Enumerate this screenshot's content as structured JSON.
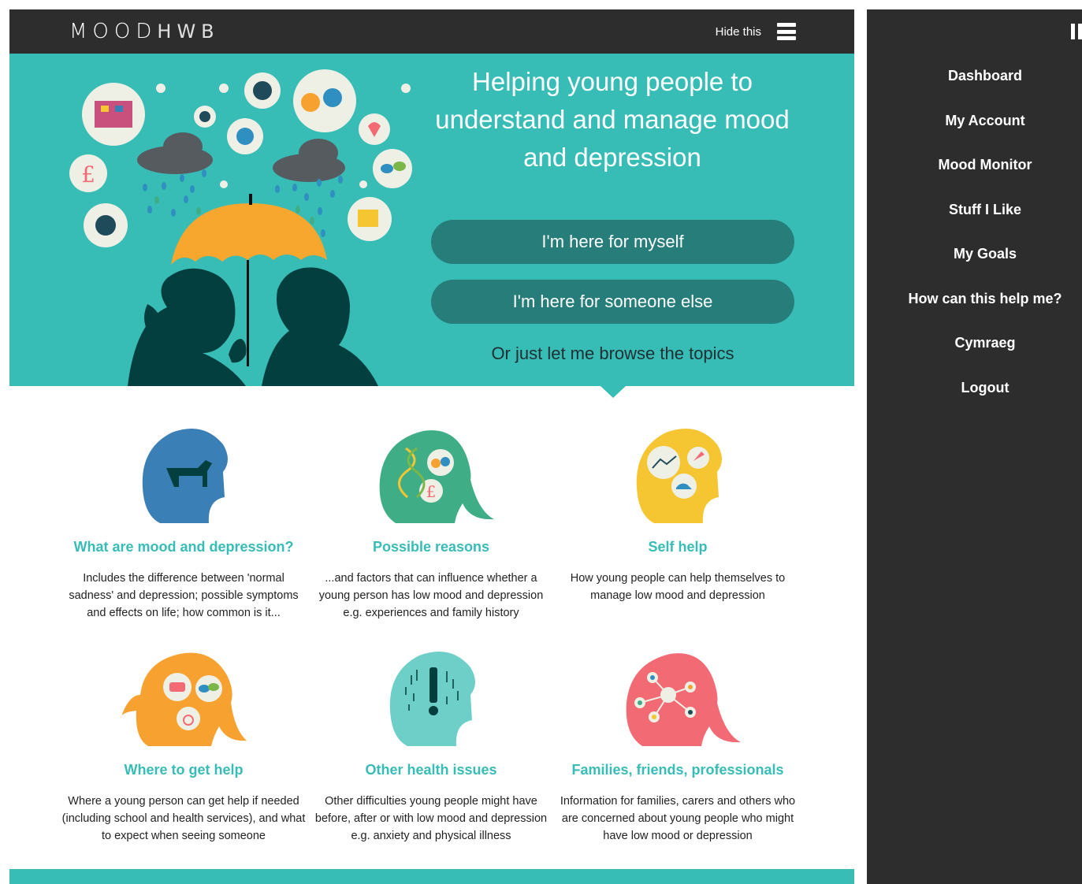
{
  "brand": {
    "logo_bold": "MOOD",
    "logo_thin": "HWB"
  },
  "header": {
    "hide_label": "Hide this",
    "menu_icon": "hamburger-icon"
  },
  "hero": {
    "title": "Helping young people to understand and manage mood and depression",
    "button_myself": "I'm here for myself",
    "button_someone": "I'm here for someone else",
    "browse_link": "Or just let me browse the topics"
  },
  "topics": [
    {
      "title": "What are mood and depression?",
      "description": "Includes the difference between 'normal sadness' and depression; possible symptoms and effects on life; how common is it...",
      "color": "#3a7fb5",
      "icon": "dog-head-icon"
    },
    {
      "title": "Possible reasons",
      "description": "...and factors that can influence whether a young person has low mood and depression e.g. experiences and family history",
      "color": "#3fae87",
      "icon": "reasons-head-icon"
    },
    {
      "title": "Self help",
      "description": "How young people can help themselves to manage low mood and depression",
      "color": "#f5c532",
      "icon": "self-help-head-icon"
    },
    {
      "title": "Where to get help",
      "description": "Where a young person can get help if needed (including school and health services), and what to expect when seeing someone",
      "color": "#f7a230",
      "icon": "help-head-icon"
    },
    {
      "title": "Other health issues",
      "description": "Other difficulties young people might have before, after or with low mood and depression e.g. anxiety and physical illness",
      "color": "#6ecfc9",
      "icon": "exclamation-head-icon"
    },
    {
      "title": "Families, friends, professionals",
      "description": "Information for families, carers and others who are concerned about young people who might have low mood or depression",
      "color": "#f26b74",
      "icon": "network-head-icon"
    }
  ],
  "sidebar": {
    "items": [
      {
        "label": "Dashboard"
      },
      {
        "label": "My Account"
      },
      {
        "label": "Mood Monitor"
      },
      {
        "label": "Stuff I Like"
      },
      {
        "label": "My Goals"
      },
      {
        "label": "How can this help me?"
      },
      {
        "label": "Cymraeg"
      },
      {
        "label": "Logout"
      }
    ]
  },
  "colors": {
    "teal": "#38bcb6",
    "dark_teal": "#277d7a",
    "dark": "#2d2d2d"
  }
}
